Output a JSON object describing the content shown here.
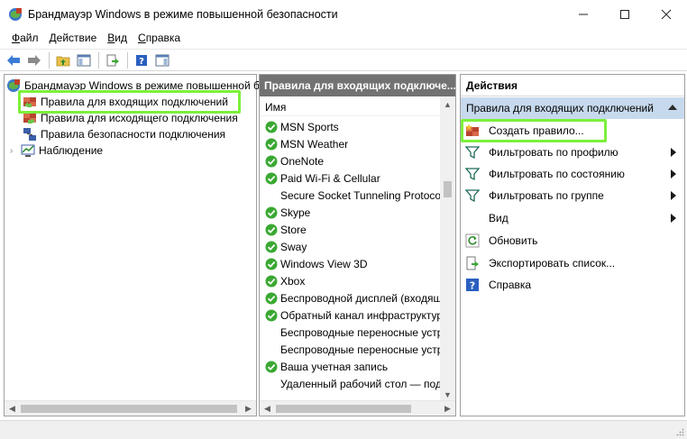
{
  "window": {
    "title": "Брандмауэр Windows в режиме повышенной безопасности"
  },
  "menu": {
    "items": [
      {
        "label_u": "Ф",
        "label_rest": "айл"
      },
      {
        "label_u": "Д",
        "label_rest": "ействие"
      },
      {
        "label_u": "В",
        "label_rest": "ид"
      },
      {
        "label_u": "С",
        "label_rest": "правка"
      }
    ]
  },
  "toolbar": {
    "icons": [
      "back-arrow-icon",
      "forward-arrow-icon",
      "up-folder-icon",
      "show-hide-console-tree-icon",
      "export-list-icon",
      "help-icon",
      "show-hide-action-pane-icon"
    ]
  },
  "tree": {
    "root": "Брандмауэр Windows в режиме повышенной безопасности",
    "items": [
      "Правила для входящих подключений",
      "Правила для исходящего подключения",
      "Правила безопасности подключения",
      "Наблюдение"
    ]
  },
  "middle": {
    "header": "Правила для входящих подключе...",
    "column": "Имя",
    "rows": [
      {
        "name": "MSN Sports",
        "enabled": true
      },
      {
        "name": "MSN Weather",
        "enabled": true
      },
      {
        "name": "OneNote",
        "enabled": true
      },
      {
        "name": "Paid Wi-Fi & Cellular",
        "enabled": true
      },
      {
        "name": "Secure Socket Tunneling Protocol",
        "enabled": false
      },
      {
        "name": "Skype",
        "enabled": true
      },
      {
        "name": "Store",
        "enabled": true
      },
      {
        "name": "Sway",
        "enabled": true
      },
      {
        "name": "Windows View 3D",
        "enabled": true
      },
      {
        "name": "Xbox",
        "enabled": true
      },
      {
        "name": "Беспроводной дисплей (входящ",
        "enabled": true
      },
      {
        "name": "Обратный канал инфраструктур",
        "enabled": true
      },
      {
        "name": "Беспроводные переносные устр",
        "enabled": false
      },
      {
        "name": "Беспроводные переносные устр",
        "enabled": false
      },
      {
        "name": "Ваша учетная запись",
        "enabled": true
      },
      {
        "name": "Удаленный рабочий стол — под",
        "enabled": false
      }
    ]
  },
  "actions": {
    "header": "Действия",
    "subheader": "Правила для входящих подключений",
    "items": [
      {
        "label": "Создать правило...",
        "icon": "new-rule-icon",
        "submenu": false
      },
      {
        "label": "Фильтровать по профилю",
        "icon": "filter-icon",
        "submenu": true
      },
      {
        "label": "Фильтровать по состоянию",
        "icon": "filter-icon",
        "submenu": true
      },
      {
        "label": "Фильтровать по группе",
        "icon": "filter-icon",
        "submenu": true
      },
      {
        "label": "Вид",
        "icon": "",
        "submenu": true
      },
      {
        "label": "Обновить",
        "icon": "refresh-icon",
        "submenu": false
      },
      {
        "label": "Экспортировать список...",
        "icon": "export-icon",
        "submenu": false
      },
      {
        "label": "Справка",
        "icon": "help-icon",
        "submenu": false
      }
    ]
  },
  "colors": {
    "highlight": "#7cf03a",
    "check_green": "#3aa832",
    "mid_header_bg": "#727272",
    "action_subheader_bg": "#c7d9ed"
  }
}
